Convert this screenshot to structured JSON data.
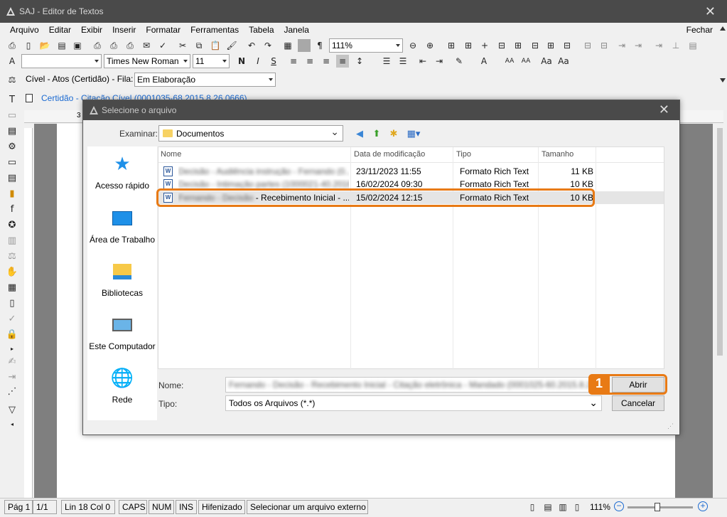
{
  "window": {
    "title": "SAJ - Editor de Textos"
  },
  "menu": {
    "items": [
      "Arquivo",
      "Editar",
      "Exibir",
      "Inserir",
      "Formatar",
      "Ferramentas",
      "Tabela",
      "Janela"
    ],
    "right": "Fechar"
  },
  "toolbar": {
    "zoom": "111%",
    "font": "Times New Roman",
    "font_size": "11",
    "bold": "N",
    "italic": "I",
    "underline": "S"
  },
  "context": {
    "label": "Cível - Atos (Certidão) - Fila:",
    "queue": "Em Elaboração"
  },
  "doc_tab": {
    "label": "Certidão - Citação Cível (0001035-68.2015.8.26.0666)"
  },
  "ruler": {
    "marks": [
      "3"
    ]
  },
  "dialog": {
    "title": "Selecione o arquivo",
    "look_in_label": "Examinar:",
    "look_in_value": "Documentos",
    "places": [
      "Acesso rápido",
      "Área de Trabalho",
      "Bibliotecas",
      "Este Computador",
      "Rede"
    ],
    "columns": [
      "Nome",
      "Data de modificação",
      "Tipo",
      "Tamanho"
    ],
    "files": [
      {
        "name_blur": "Decisão - Audiência instrução - Fernando (0...",
        "name_visible": "",
        "date": "23/11/2023 11:55",
        "type": "Formato Rich Text",
        "size": "11 KB",
        "selected": false
      },
      {
        "name_blur": "Decisão - Intimação partes (1000021-40.2016.8...",
        "name_visible": "",
        "date": "16/02/2024 09:30",
        "type": "Formato Rich Text",
        "size": "10 KB",
        "selected": false
      },
      {
        "name_blur": "Fernando - Decisão",
        "name_visible": " - Recebimento Inicial - ...",
        "date": "15/02/2024 12:15",
        "type": "Formato Rich Text",
        "size": "10 KB",
        "selected": true
      }
    ],
    "name_label": "Nome:",
    "name_value": "Fernando - Decisão - Recebimento Inicial - Citação eletrônica - Mandado (0001025-60.2015.8.26.0666)(1)",
    "type_label": "Tipo:",
    "type_value": "Todos os Arquivos (*.*)",
    "open_button": "Abrir",
    "cancel_button": "Cancelar",
    "step_badge": "1",
    "highlight_color": "#e87a15"
  },
  "status": {
    "page": "Pág 1",
    "pages": "1/1",
    "position": "Lin 18  Col 0",
    "caps": "CAPS",
    "num": "NUM",
    "ins": "INS",
    "hyphen": "Hifenizado",
    "message": "Selecionar um arquivo externo",
    "zoom": "111%",
    "zoom_level": 0.45
  }
}
